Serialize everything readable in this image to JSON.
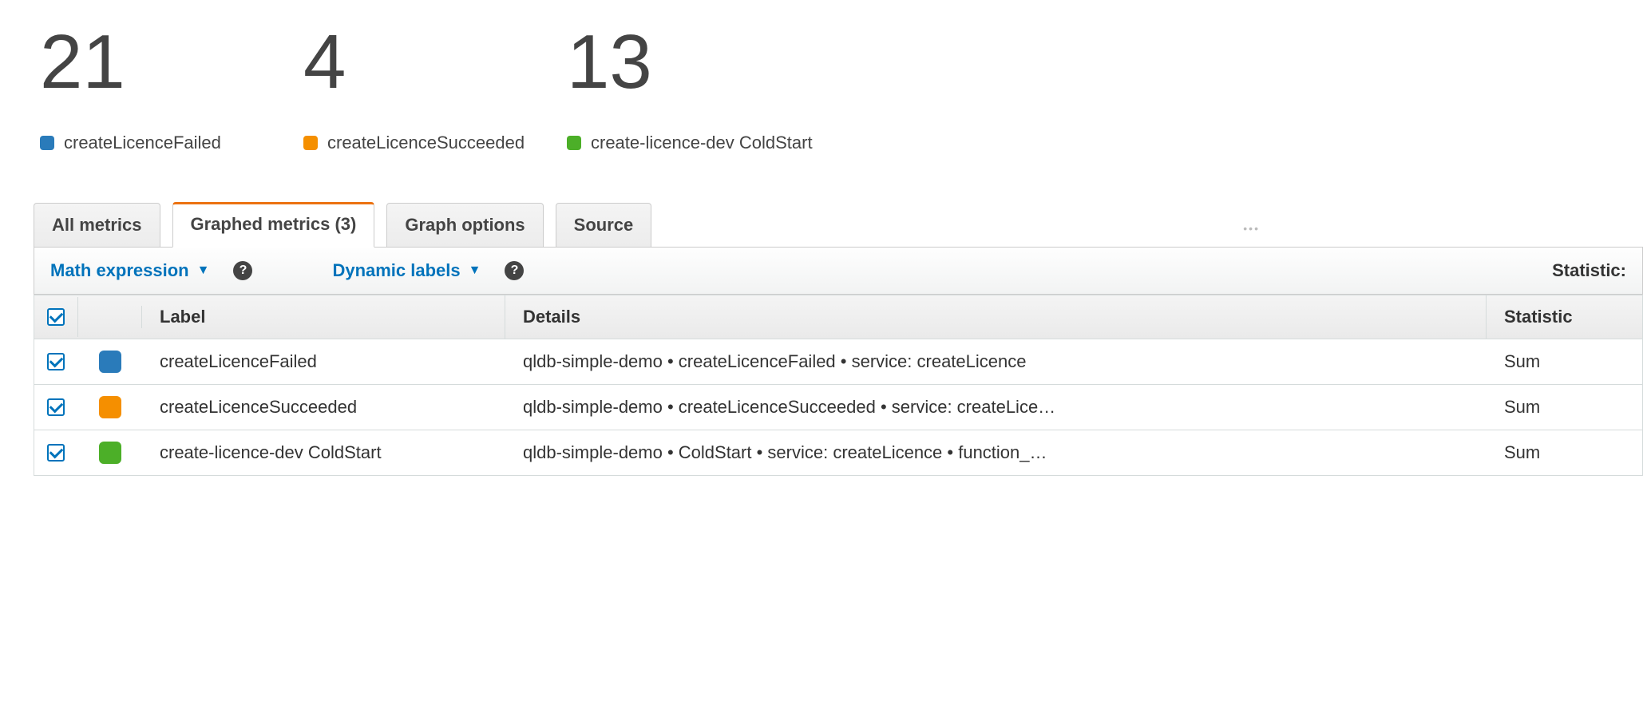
{
  "colors": {
    "blue": "#2a7bba",
    "orange": "#f58f00",
    "green": "#4caf28"
  },
  "stats": [
    {
      "value": "21",
      "label": "createLicenceFailed",
      "color": "blue"
    },
    {
      "value": "4",
      "label": "createLicenceSucceeded",
      "color": "orange"
    },
    {
      "value": "13",
      "label": "create-licence-dev ColdStart",
      "color": "green"
    }
  ],
  "tabs": [
    {
      "label": "All metrics",
      "active": false
    },
    {
      "label": "Graphed metrics (3)",
      "active": true
    },
    {
      "label": "Graph options",
      "active": false
    },
    {
      "label": "Source",
      "active": false
    }
  ],
  "toolbar": {
    "math_expression": "Math expression",
    "dynamic_labels": "Dynamic labels",
    "statistic_label": "Statistic:"
  },
  "table": {
    "headers": {
      "label": "Label",
      "details": "Details",
      "statistic": "Statistic"
    },
    "rows": [
      {
        "checked": true,
        "color": "blue",
        "label": "createLicenceFailed",
        "details": "qldb-simple-demo • createLicenceFailed • service: createLicence",
        "statistic": "Sum"
      },
      {
        "checked": true,
        "color": "orange",
        "label": "createLicenceSucceeded",
        "details": "qldb-simple-demo • createLicenceSucceeded • service: createLice…",
        "statistic": "Sum"
      },
      {
        "checked": true,
        "color": "green",
        "label": "create-licence-dev ColdStart",
        "details": "qldb-simple-demo • ColdStart • service: createLicence • function_…",
        "statistic": "Sum"
      }
    ]
  }
}
